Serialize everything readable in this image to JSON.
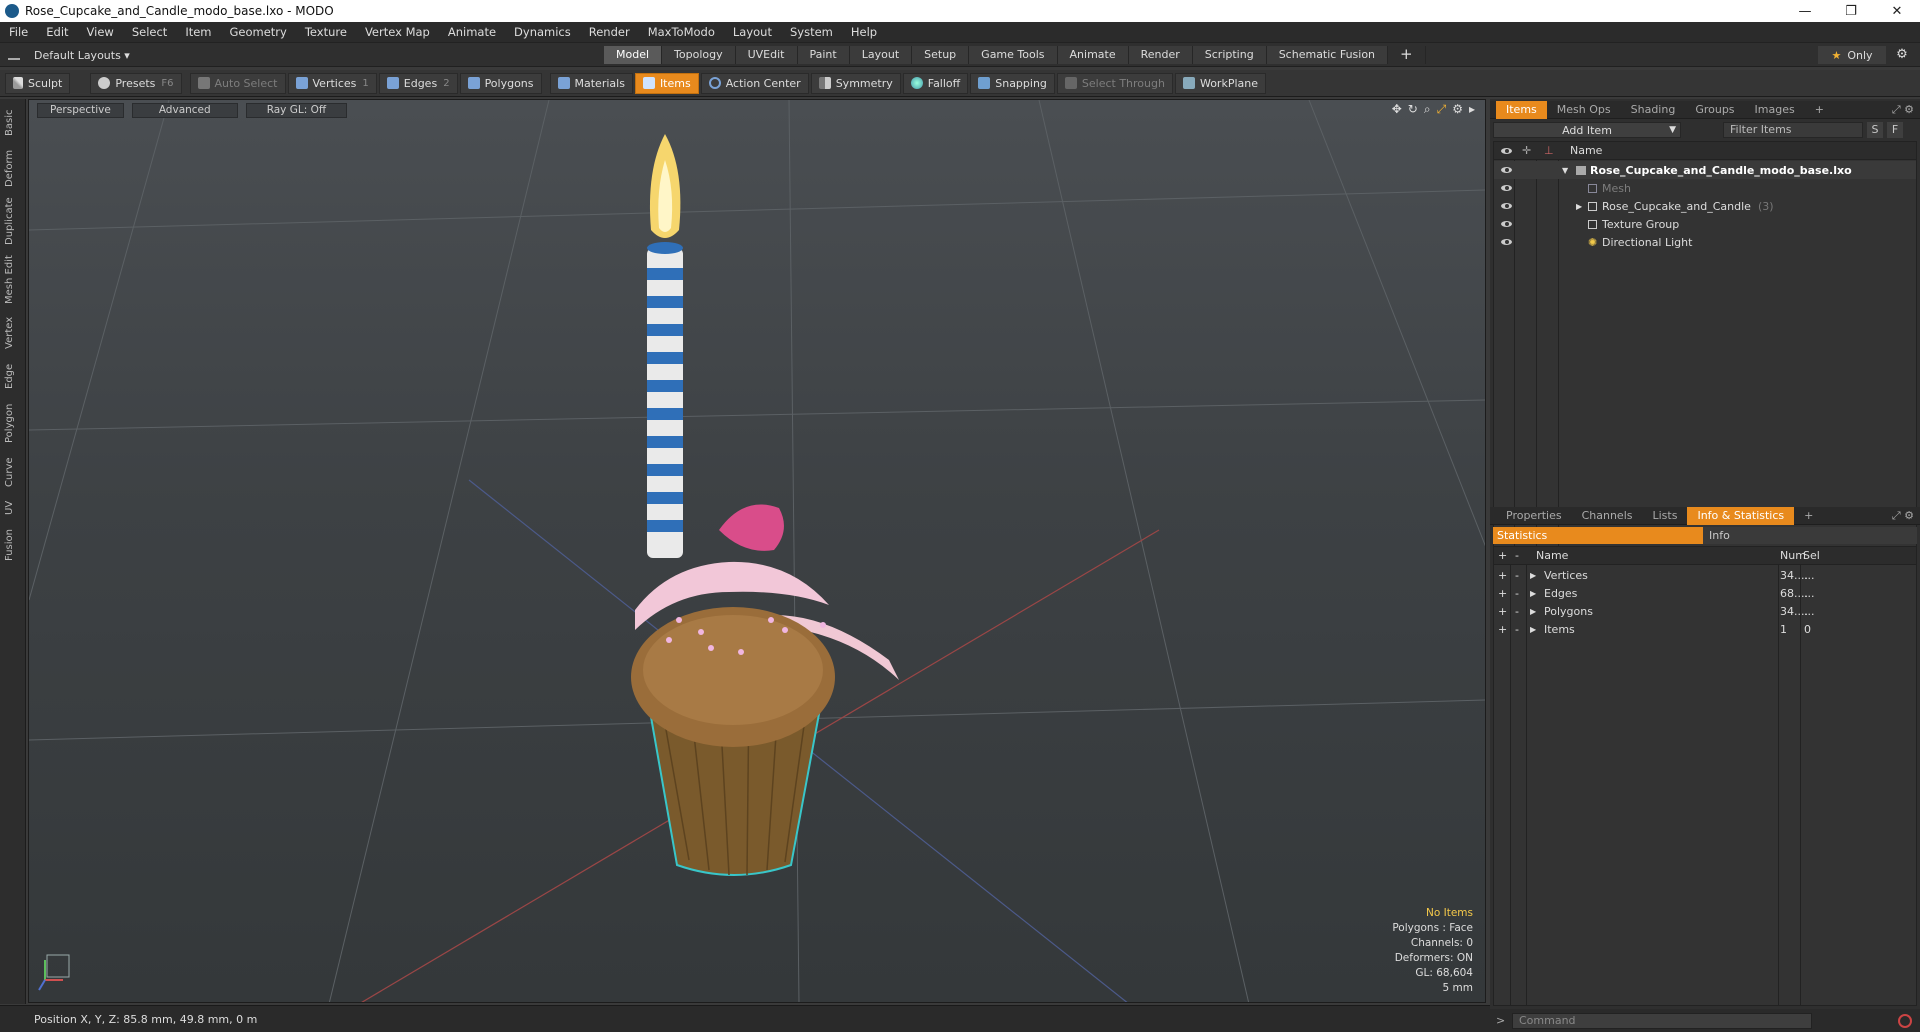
{
  "window": {
    "title": "Rose_Cupcake_and_Candle_modo_base.lxo - MODO",
    "controls": [
      "—",
      "❐",
      "✕"
    ]
  },
  "menu": [
    "File",
    "Edit",
    "View",
    "Select",
    "Item",
    "Geometry",
    "Texture",
    "Vertex Map",
    "Animate",
    "Dynamics",
    "Render",
    "MaxToModo",
    "Layout",
    "System",
    "Help"
  ],
  "layoutbar": {
    "layout": "Default Layouts ▾",
    "tabs": [
      "Model",
      "Topology",
      "UVEdit",
      "Paint",
      "Layout",
      "Setup",
      "Game Tools",
      "Animate",
      "Render",
      "Scripting",
      "Schematic Fusion",
      "+"
    ],
    "active_tab": "Model",
    "only_label": "Only"
  },
  "toolbar": {
    "sculpt": "Sculpt",
    "presets": "Presets",
    "presets_key": "F6",
    "auto_select": "Auto Select",
    "vertices": "Vertices",
    "vertices_key": "1",
    "edges": "Edges",
    "edges_key": "2",
    "polygons": "Polygons",
    "materials": "Materials",
    "items": "Items",
    "action_center": "Action Center",
    "symmetry": "Symmetry",
    "falloff": "Falloff",
    "snapping": "Snapping",
    "select_through": "Select Through",
    "workplane": "WorkPlane"
  },
  "leftstrip": [
    "Basic",
    "Deform",
    "Duplicate",
    "Mesh Edit",
    "Vertex",
    "Edge",
    "Polygon",
    "Curve",
    "UV",
    "Fusion"
  ],
  "viewport": {
    "view": "Perspective",
    "shading": "Advanced",
    "raygl": "Ray GL: Off",
    "stats": {
      "selection": "No Items",
      "polygons": "Polygons : Face",
      "channels": "Channels: 0",
      "deformers": "Deformers: ON",
      "gl": "GL: 68,604",
      "grid": "5 mm"
    }
  },
  "status": {
    "position": "Position X, Y, Z:  85.8 mm, 49.8 mm, 0 m"
  },
  "items_panel": {
    "tabs": [
      "Items",
      "Mesh Ops",
      "Shading",
      "Groups",
      "Images",
      "+"
    ],
    "active": "Items",
    "add_item": "Add Item",
    "filter": "Filter Items",
    "s": "S",
    "f": "F",
    "col_name": "Name",
    "tree": [
      {
        "label": "Rose_Cupcake_and_Candle_modo_base.lxo",
        "depth": 0,
        "bold": true,
        "arrow": "▼"
      },
      {
        "label": "Mesh",
        "depth": 1,
        "dim": true,
        "arrow": ""
      },
      {
        "label": "Rose_Cupcake_and_Candle",
        "suffix": "(3)",
        "depth": 1,
        "arrow": "▶"
      },
      {
        "label": "Texture Group",
        "depth": 1,
        "arrow": ""
      },
      {
        "label": "Directional Light",
        "depth": 1,
        "arrow": ""
      }
    ]
  },
  "props_panel": {
    "tabs": [
      "Properties",
      "Channels",
      "Lists",
      "Info & Statistics",
      "+"
    ],
    "active": "Info & Statistics",
    "sub_tabs": [
      "Statistics",
      "Info"
    ],
    "cols": [
      "Name",
      "Num",
      "Sel"
    ],
    "rows": [
      {
        "name": "Vertices",
        "num": "34....",
        "sel": "..."
      },
      {
        "name": "Edges",
        "num": "68....",
        "sel": "..."
      },
      {
        "name": "Polygons",
        "num": "34....",
        "sel": "..."
      },
      {
        "name": "Items",
        "num": "1",
        "sel": "0"
      }
    ]
  },
  "command": {
    "placeholder": "Command"
  },
  "colors": {
    "accent": "#e88a1d",
    "viewport_bg": "#3d4144"
  }
}
